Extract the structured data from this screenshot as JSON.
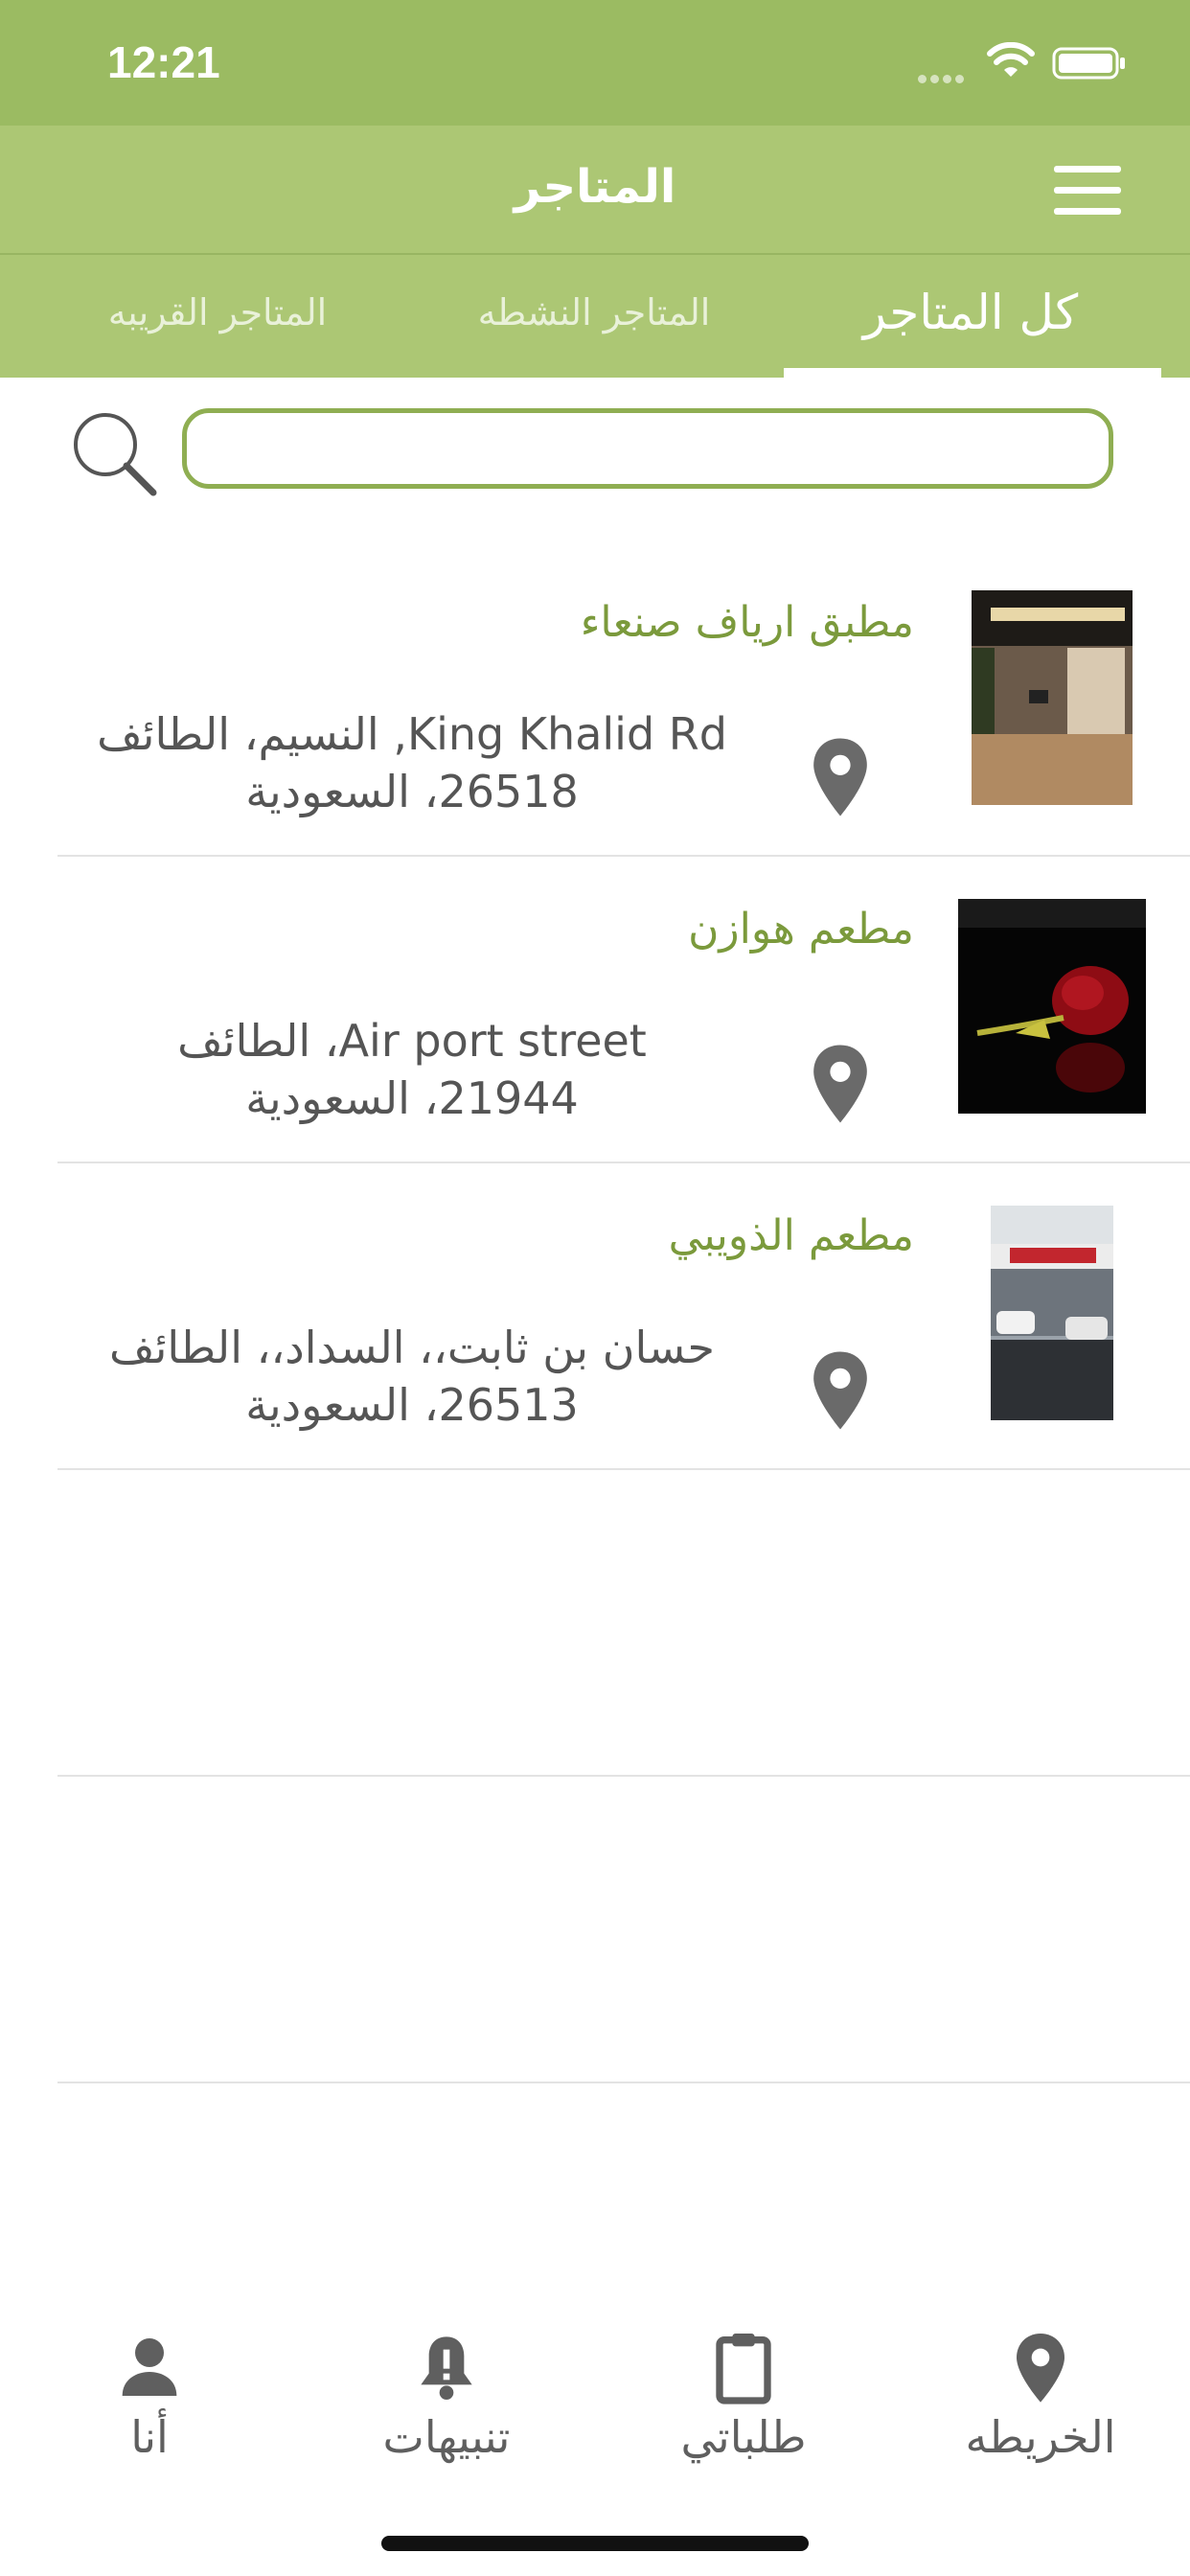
{
  "status_bar": {
    "time": "12:21"
  },
  "header": {
    "title": "المتاجر"
  },
  "tabs": [
    {
      "label": "كل المتاجر",
      "active": true
    },
    {
      "label": "المتاجر النشطه",
      "active": false
    },
    {
      "label": "المتاجر القريبه",
      "active": false
    }
  ],
  "search": {
    "value": "",
    "placeholder": ""
  },
  "stores": [
    {
      "name": "مطبق ارياف صنعاء",
      "address_line1": "King Khalid Rd, النسيم، الطائف",
      "address_line2": "26518، السعودية"
    },
    {
      "name": "مطعم هوازن",
      "address_line1": "Air port street، الطائف",
      "address_line2": "21944، السعودية"
    },
    {
      "name": "مطعم الذويبي",
      "address_line1": "حسان بن ثابت،، السداد،، الطائف",
      "address_line2": "26513، السعودية"
    }
  ],
  "bottom_nav": [
    {
      "label": "الخريطه",
      "icon": "map-pin-icon"
    },
    {
      "label": "طلباتي",
      "icon": "clipboard-icon"
    },
    {
      "label": "تنبيهات",
      "icon": "bell-alert-icon"
    },
    {
      "label": "أنا",
      "icon": "person-icon"
    }
  ],
  "colors": {
    "primary": "#acc774",
    "status_bar": "#9bbb62",
    "accent_text": "#7b9a3c",
    "search_border": "#8fae52"
  }
}
